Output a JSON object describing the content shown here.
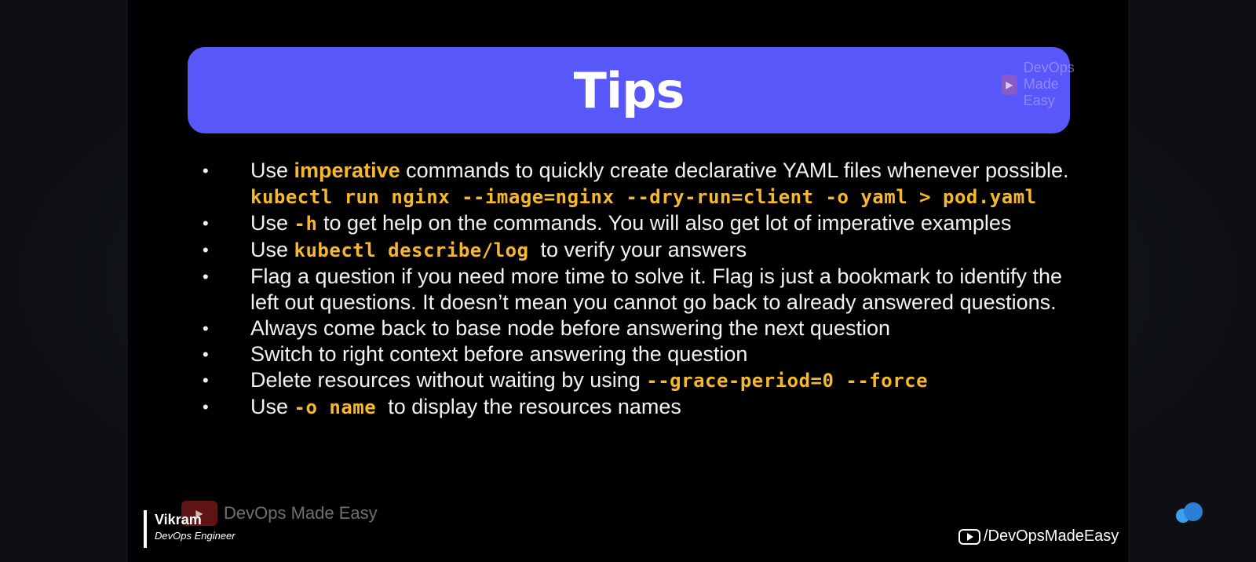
{
  "slide": {
    "title": "Tips",
    "watermark_top": "DevOps Made Easy",
    "tips": [
      {
        "segments": [
          {
            "text": "Use ",
            "style": "plain"
          },
          {
            "text": "imperative",
            "style": "kw"
          },
          {
            "text": " commands to quickly create declarative YAML files whenever possible. ",
            "style": "plain"
          },
          {
            "text": "kubectl run nginx --image=nginx --dry-run=client -o yaml > pod.yaml",
            "style": "code"
          }
        ]
      },
      {
        "segments": [
          {
            "text": "Use ",
            "style": "plain"
          },
          {
            "text": "-h",
            "style": "code"
          },
          {
            "text": " to get help on the commands. You will also get lot of imperative examples",
            "style": "plain"
          }
        ]
      },
      {
        "segments": [
          {
            "text": "Use ",
            "style": "plain"
          },
          {
            "text": "kubectl describe/log",
            "style": "code"
          },
          {
            "text": "  to verify your answers",
            "style": "plain"
          }
        ]
      },
      {
        "segments": [
          {
            "text": "Flag a question if you need more time to solve it. Flag is just a bookmark to identify the left out questions. It doesn’t mean you cannot go back to already answered questions.",
            "style": "plain"
          }
        ]
      },
      {
        "segments": [
          {
            "text": "Always come back to base node before answering the next question",
            "style": "plain"
          }
        ]
      },
      {
        "segments": [
          {
            "text": "Switch to right context before answering the question",
            "style": "plain"
          }
        ]
      },
      {
        "segments": [
          {
            "text": "Delete resources without waiting by using ",
            "style": "plain"
          },
          {
            "text": "--grace-period=0 --force",
            "style": "code"
          }
        ]
      },
      {
        "segments": [
          {
            "text": "Use ",
            "style": "plain"
          },
          {
            "text": "-o name",
            "style": "code"
          },
          {
            "text": "  to display the resources names",
            "style": "plain"
          }
        ]
      }
    ],
    "bullet": "•",
    "watermark_bottom": "DevOps Made Easy",
    "presenter": {
      "name": "Vikram",
      "role": "DevOps Engineer"
    },
    "channel_handle": "/DevOpsMadeEasy"
  },
  "icons": {
    "watermark_logo": "play-icon",
    "channel_logo": "youtube-icon",
    "corner_logo": "cloud-icon"
  },
  "colors": {
    "banner": "#5858fa",
    "highlight": "#f5b82e",
    "slide_bg": "#000000",
    "text": "#f2f2f2"
  }
}
